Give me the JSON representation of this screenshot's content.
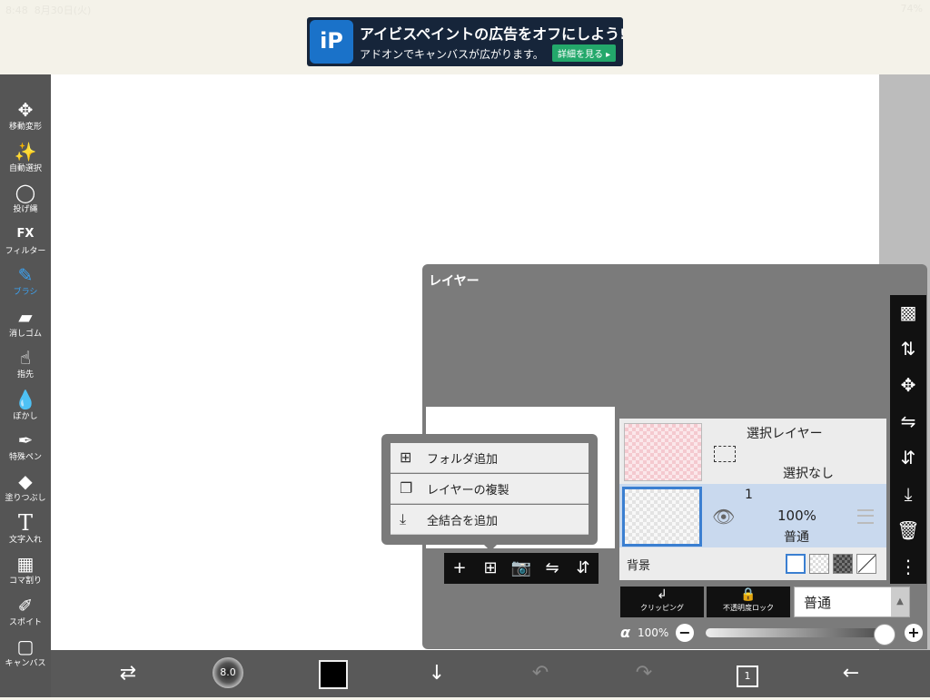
{
  "status_bar": {
    "time": "8:48",
    "date": "8月30日(火)",
    "battery": "74%"
  },
  "ad": {
    "logo_text": "iP",
    "line1": "アイビスペイントの広告をオフにしよう!",
    "line2": "アドオンでキャンバスが広がります。",
    "cta": "詳細を見る ▸"
  },
  "toolbar": {
    "tools": [
      {
        "label": "移動変形",
        "icon": "move-icon",
        "glyph": "✥"
      },
      {
        "label": "自動選択",
        "icon": "magic-wand-icon",
        "glyph": "✨"
      },
      {
        "label": "投げ縄",
        "icon": "lasso-icon",
        "glyph": "◯"
      },
      {
        "label": "フィルター",
        "icon": "fx-icon",
        "glyph": "FX"
      },
      {
        "label": "ブラシ",
        "icon": "brush-icon",
        "glyph": "✎"
      },
      {
        "label": "消しゴム",
        "icon": "eraser-icon",
        "glyph": "▰"
      },
      {
        "label": "指先",
        "icon": "smudge-icon",
        "glyph": "☝"
      },
      {
        "label": "ぼかし",
        "icon": "blur-icon",
        "glyph": "💧"
      },
      {
        "label": "特殊ペン",
        "icon": "special-pen-icon",
        "glyph": "✒"
      },
      {
        "label": "塗りつぶし",
        "icon": "fill-icon",
        "glyph": "◆"
      },
      {
        "label": "文字入れ",
        "icon": "text-icon",
        "glyph": "T"
      },
      {
        "label": "コマ割り",
        "icon": "frame-divider-icon",
        "glyph": "▦"
      },
      {
        "label": "スポイト",
        "icon": "eyedropper-icon",
        "glyph": "✐"
      },
      {
        "label": "キャンバス",
        "icon": "canvas-icon",
        "glyph": "▢"
      }
    ],
    "active_tool": "ブラシ",
    "accent": "#3ba3f4"
  },
  "bottom_bar": {
    "brush_size": "8.0",
    "current_color": "#000000",
    "page_count": "1"
  },
  "layer_panel": {
    "title": "レイヤー",
    "selection_layer": {
      "name": "選択レイヤー",
      "state": "選択なし"
    },
    "layer": {
      "number": "1",
      "opacity": "100%",
      "blend": "普通"
    },
    "background_label": "背景",
    "clipping_label": "クリッピング",
    "opacity_lock_label": "不透明度ロック",
    "blend_mode": "普通",
    "alpha_symbol": "α",
    "alpha_value": "100%",
    "alpha_level": 1.0
  },
  "popup_menu": {
    "items": [
      {
        "label": "フォルダ追加",
        "icon": "add-folder-icon",
        "glyph": "⊞"
      },
      {
        "label": "レイヤーの複製",
        "icon": "duplicate-layer-icon",
        "glyph": "❐"
      },
      {
        "label": "全結合を追加",
        "icon": "merge-all-icon",
        "glyph": "⤓"
      }
    ]
  },
  "colors": {
    "toolbar_bg": "#555555",
    "panel_bg": "#7b7b7b",
    "selected_layer_bg": "#c9d9ee",
    "selection_border": "#3b7fd1",
    "ad_cta": "#23a86b"
  }
}
